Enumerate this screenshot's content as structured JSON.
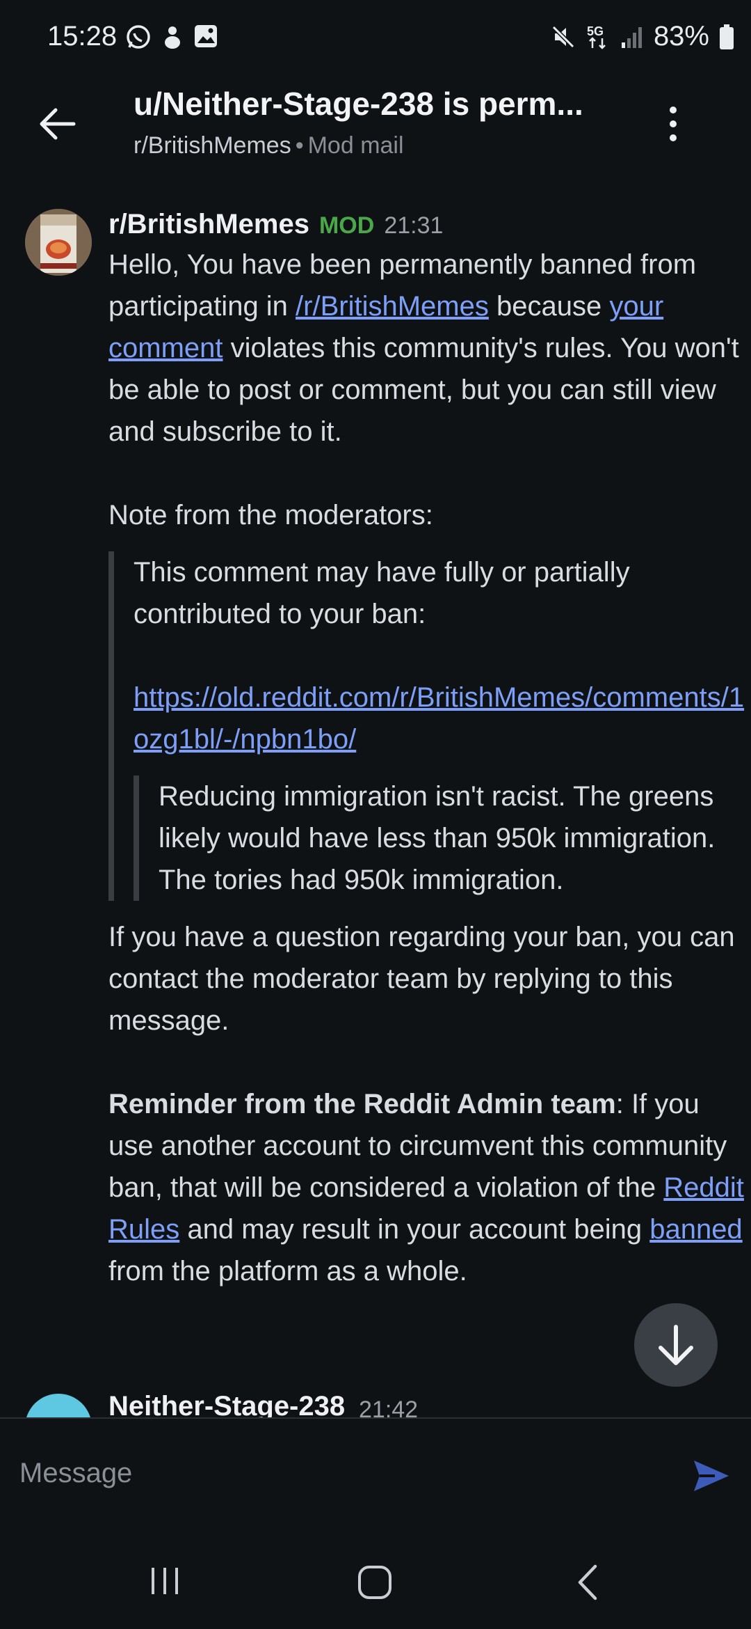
{
  "status_bar": {
    "time": "15:28",
    "battery": "83%",
    "left_icons": [
      "whatsapp-icon",
      "app-icon",
      "gallery-icon"
    ],
    "right_icons": [
      "mute-icon",
      "5g-icon",
      "signal-icon",
      "battery-icon"
    ]
  },
  "header": {
    "title": "u/Neither-Stage-238 is perm...",
    "subreddit": "r/BritishMemes",
    "separator": "•",
    "category": "Mod mail"
  },
  "message": {
    "author": "r/BritishMemes",
    "badge": "MOD",
    "time": "21:31",
    "p1_a": "Hello, You have been permanently banned from participating in ",
    "p1_link1": "/r/BritishMemes",
    "p1_b": " because ",
    "p1_link2": "your comment",
    "p1_c": " violates this community's rules. You won't be able to post or comment, but you can still view and subscribe to it.",
    "note_label": "Note from the moderators:",
    "quote_text": "This comment may have fully or partially contributed to your ban:",
    "quote_link": "https://old.reddit.com/r/BritishMemes/comments/1ozg1bl/-/npbn1bo/",
    "nested_quote": "Reducing immigration isn't racist. The greens likely would have less than 950k immigration. The tories had 950k immigration.",
    "p2": "If you have a question regarding your ban, you can contact the moderator team by replying to this message.",
    "reminder_bold": "Reminder from the Reddit Admin team",
    "reminder_a": ": If you use another account to circumvent this community ban, that will be considered a violation of the ",
    "reminder_link1": "Reddit Rules",
    "reminder_b": " and may result in your account being ",
    "reminder_link2": "banned",
    "reminder_c": " from the platform as a whole."
  },
  "next_message": {
    "author": "Neither-Stage-238",
    "time": "21:42"
  },
  "composer": {
    "placeholder": "Message"
  },
  "colors": {
    "background": "#0f1215",
    "link": "#7e9ff7",
    "mod_badge": "#4aa84a",
    "send_icon": "#3d5bb8"
  }
}
